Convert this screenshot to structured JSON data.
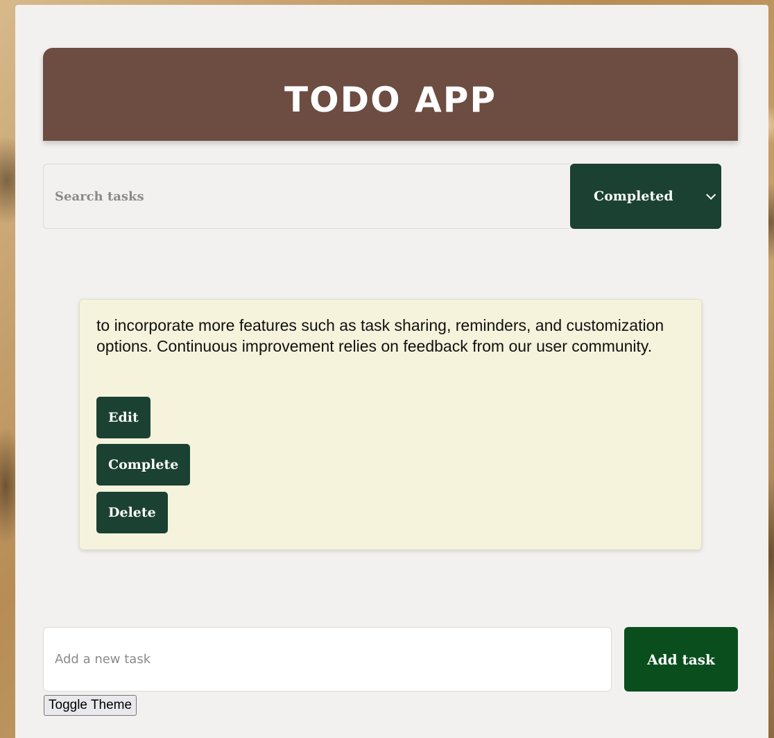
{
  "header": {
    "title": "TODO APP"
  },
  "search": {
    "placeholder": "Search tasks",
    "value": ""
  },
  "filter": {
    "selected": "Completed",
    "icon": "chevron-down-icon"
  },
  "tasks": [
    {
      "text": "to incorporate more features such as task sharing, reminders, and customization options. Continuous improvement relies on feedback from our user community.",
      "actions": {
        "edit_label": "Edit",
        "complete_label": "Complete",
        "delete_label": "Delete"
      }
    }
  ],
  "add_task": {
    "placeholder": "Add a new task",
    "value": "",
    "button_label": "Add task"
  },
  "theme": {
    "toggle_label": "Toggle Theme"
  },
  "colors": {
    "header_bg": "#6d4c41",
    "button_dark_green": "#1a4131",
    "add_button_green": "#0a4e1e",
    "task_card_bg": "#f5f3dc",
    "panel_bg": "#f2f1f0"
  }
}
